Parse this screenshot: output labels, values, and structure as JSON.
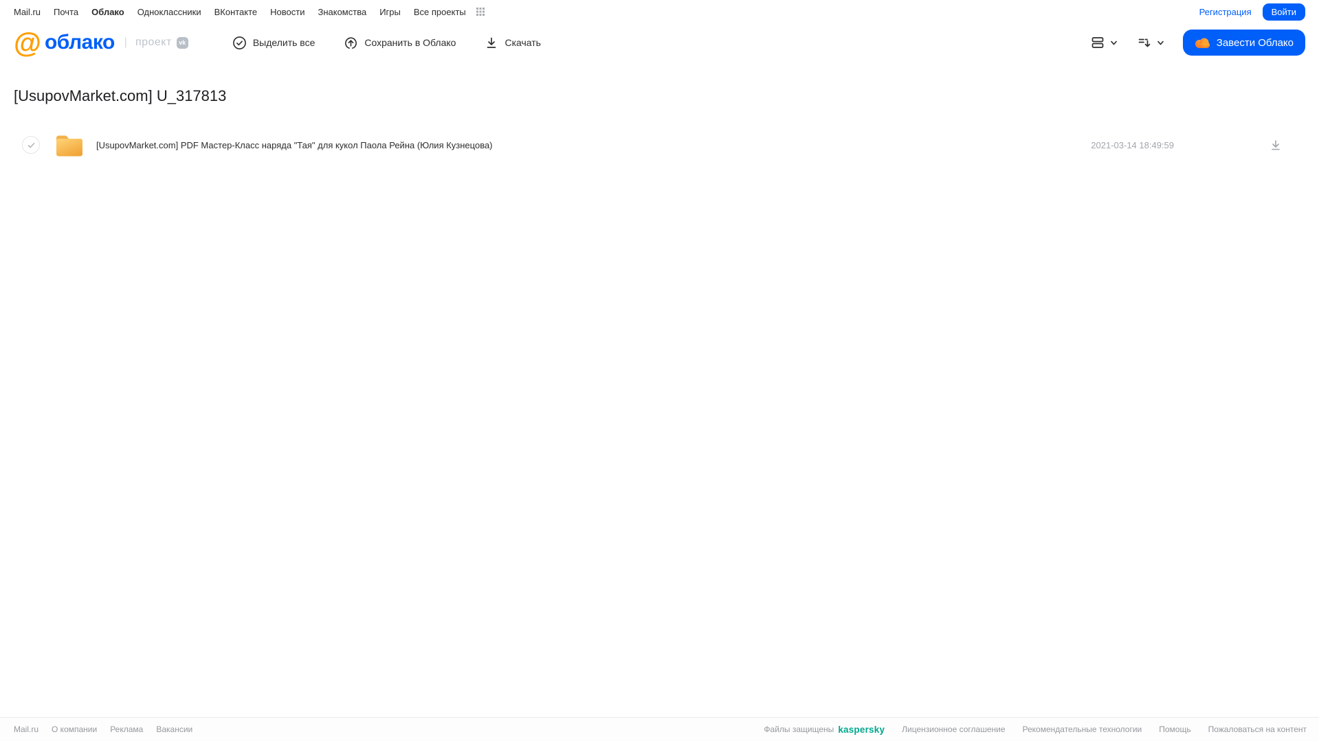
{
  "top_nav": {
    "items": [
      {
        "label": "Mail.ru"
      },
      {
        "label": "Почта"
      },
      {
        "label": "Облако",
        "active": true
      },
      {
        "label": "Одноклассники"
      },
      {
        "label": "ВКонтакте"
      },
      {
        "label": "Новости"
      },
      {
        "label": "Знакомства"
      },
      {
        "label": "Игры"
      },
      {
        "label": "Все проекты"
      }
    ],
    "registration_label": "Регистрация",
    "login_label": "Войти"
  },
  "toolbar": {
    "logo_at": "@",
    "logo_text": "облако",
    "separator": "|",
    "project_label": "проект",
    "vk_badge_label": "vk",
    "select_all_label": "Выделить все",
    "save_to_cloud_label": "Сохранить в Облако",
    "download_label": "Скачать",
    "get_cloud_label": "Завести Облако"
  },
  "main": {
    "title": "[UsupovMarket.com] U_317813",
    "files": [
      {
        "type": "folder",
        "name": "[UsupovMarket.com] PDF Мастер-Класс наряда \"Тая\" для кукол Паола Рейна (Юлия Кузнецова)",
        "date": "2021-03-14 18:49:59"
      }
    ]
  },
  "footer": {
    "left_links": [
      "Mail.ru",
      "О компании",
      "Реклама",
      "Вакансии"
    ],
    "protected_text": "Файлы защищены",
    "kaspersky_label": "kaspersky",
    "right_links": [
      "Лицензионное соглашение",
      "Рекомендательные технологии",
      "Помощь",
      "Пожаловаться на контент"
    ]
  },
  "colors": {
    "brand_blue": "#005ff9",
    "logo_orange": "#ff9e00",
    "folder_yellow": "#ffc04d",
    "kaspersky_green": "#00a88e"
  }
}
